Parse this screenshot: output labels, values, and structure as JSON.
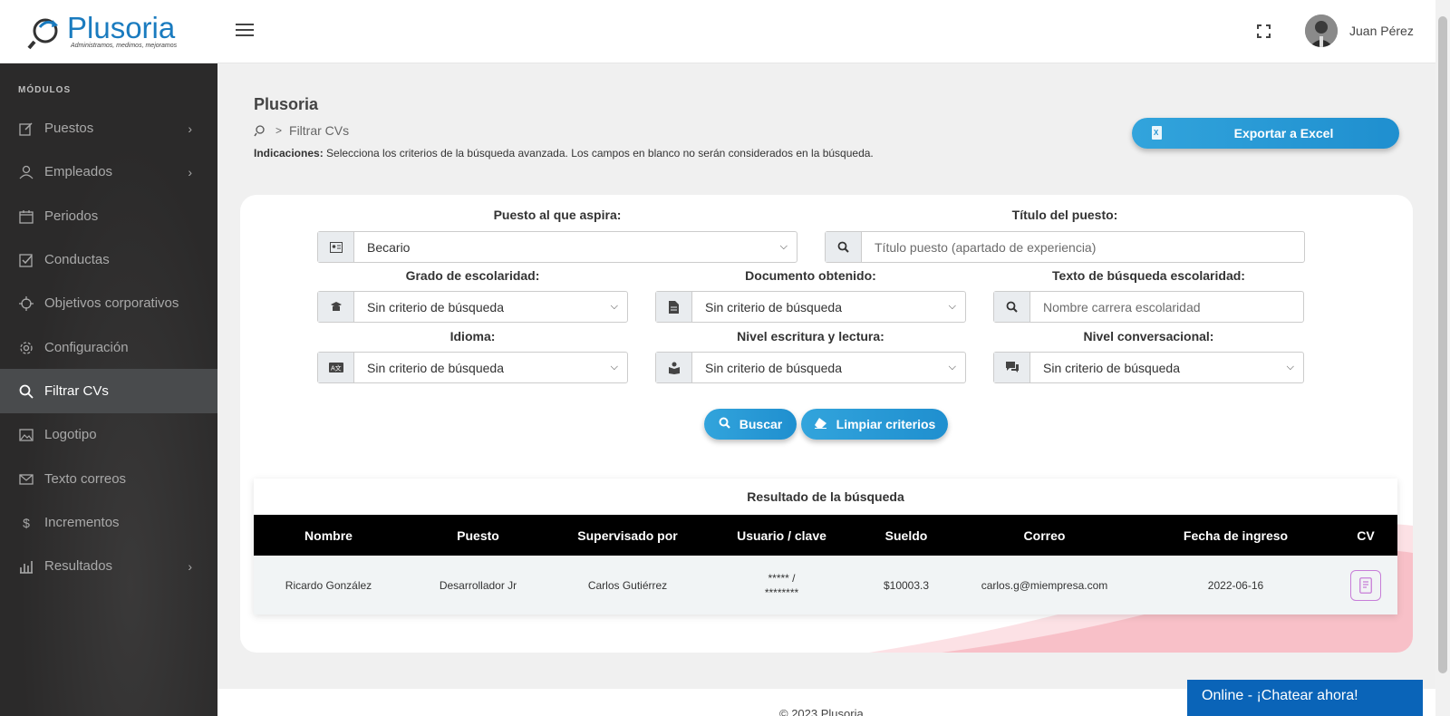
{
  "header": {
    "logo_name": "Plusoria",
    "logo_tagline": "Administramos, medimos, mejoramos",
    "user_name": "Juan Pérez"
  },
  "sidebar": {
    "title": "MÓDULOS",
    "items": [
      {
        "label": "Puestos",
        "icon": "edit-icon",
        "has_submenu": true
      },
      {
        "label": "Empleados",
        "icon": "user-icon",
        "has_submenu": true
      },
      {
        "label": "Periodos",
        "icon": "calendar-icon",
        "has_submenu": false
      },
      {
        "label": "Conductas",
        "icon": "checkbox-icon",
        "has_submenu": false
      },
      {
        "label": "Objetivos corporativos",
        "icon": "crosshair-icon",
        "has_submenu": false
      },
      {
        "label": "Configuración",
        "icon": "gear-icon",
        "has_submenu": false
      },
      {
        "label": "Filtrar CVs",
        "icon": "search-icon",
        "has_submenu": false,
        "active": true
      },
      {
        "label": "Logotipo",
        "icon": "image-icon",
        "has_submenu": false
      },
      {
        "label": "Texto correos",
        "icon": "envelope-icon",
        "has_submenu": false
      },
      {
        "label": "Incrementos",
        "icon": "dollar-icon",
        "has_submenu": false
      },
      {
        "label": "Resultados",
        "icon": "bar-chart-icon",
        "has_submenu": true
      }
    ]
  },
  "page": {
    "title": "Plusoria",
    "breadcrumb_current": "Filtrar CVs",
    "indications_label": "Indicaciones:",
    "indications_text": " Selecciona los criterios de la búsqueda avanzada. Los campos en blanco no serán considerados en la búsqueda.",
    "export_label": "Exportar a Excel"
  },
  "form": {
    "puesto_label": "Puesto al que aspira:",
    "puesto_value": "Becario",
    "titulo_label": "Título del puesto:",
    "titulo_placeholder": "Título puesto (apartado de experiencia)",
    "grado_label": "Grado de escolaridad:",
    "grado_value": "Sin criterio de búsqueda",
    "documento_label": "Documento obtenido:",
    "documento_value": "Sin criterio de búsqueda",
    "texto_esc_label": "Texto de búsqueda escolaridad:",
    "texto_esc_placeholder": "Nombre carrera escolaridad",
    "idioma_label": "Idioma:",
    "idioma_value": "Sin criterio de búsqueda",
    "nivel_escritura_label": "Nivel escritura y lectura:",
    "nivel_escritura_value": "Sin criterio de búsqueda",
    "nivel_conv_label": "Nivel conversacional:",
    "nivel_conv_value": "Sin criterio de búsqueda",
    "buscar_label": "Buscar",
    "limpiar_label": "Limpiar criterios"
  },
  "results": {
    "title": "Resultado de la búsqueda",
    "columns": [
      "Nombre",
      "Puesto",
      "Supervisado por",
      "Usuario / clave",
      "Sueldo",
      "Correo",
      "Fecha de ingreso",
      "CV"
    ],
    "rows": [
      {
        "nombre": "Ricardo González",
        "puesto": "Desarrollador Jr",
        "supervisor": "Carlos Gutiérrez",
        "usuario": "***** /",
        "clave": "********",
        "sueldo": "$10003.3",
        "correo": "carlos.g@miempresa.com",
        "fecha": "2022-06-16"
      }
    ]
  },
  "footer": {
    "copyright": "© 2023 Plusoria",
    "chat_label": "Online - ¡Chatear ahora!"
  },
  "colors": {
    "accent_blue": "#1f8fcf",
    "sidebar_bg": "#2b2a2a",
    "sidebar_active": "#494b4d",
    "table_header": "#000000",
    "cv_button_border": "#c77dd8",
    "chat_bg": "#0a64b8"
  }
}
